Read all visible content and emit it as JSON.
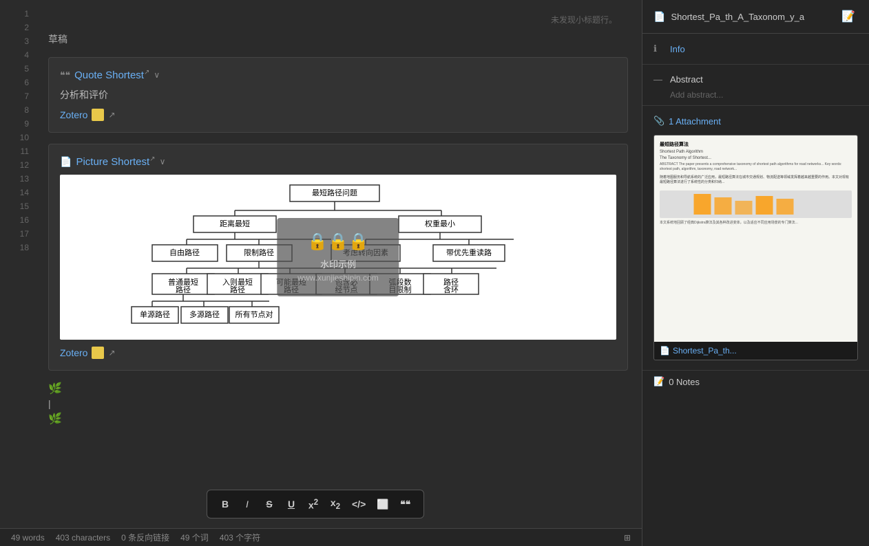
{
  "app": {
    "title": "草稿",
    "no_heading_text": "未发现小标题行。"
  },
  "editor": {
    "line_numbers": [
      1,
      2,
      3,
      4,
      5,
      6,
      7,
      8,
      9,
      10,
      11,
      12,
      13,
      14,
      15,
      16,
      17,
      18
    ],
    "blocks": [
      {
        "id": "quote-block",
        "type": "quote",
        "title": "Quote Shortest",
        "subtitle": "分析和评价",
        "zotero_label": "Zotero",
        "has_link_icon": true
      },
      {
        "id": "picture-block",
        "type": "picture",
        "title": "Picture Shortest",
        "zotero_label": "Zotero",
        "has_link_icon": true
      }
    ],
    "tree_diagram": {
      "root": "最短路径问题",
      "level1": [
        "距离最短",
        "权重最小"
      ],
      "level2_left": [
        "自由路径",
        "限制路径",
        "考虑转向因素",
        "带优先重读路"
      ],
      "level2_right": [],
      "level3": [
        "普通最短路径",
        "入则最短路径",
        "可能最短路径",
        "包含必经节点",
        "弧段数目限制",
        "路径含环"
      ],
      "level4": [
        "单源路径",
        "多源路径",
        "所有节点对"
      ]
    },
    "watermark": {
      "text": "水印示例",
      "url": "www.xunjieshipin.com"
    }
  },
  "toolbar": {
    "bold": "B",
    "italic": "I",
    "strikethrough": "S",
    "underline": "U",
    "superscript": "x²",
    "subscript": "x₂",
    "code": "</>",
    "box": "□",
    "quote": "❝"
  },
  "status_bar": {
    "words": "49 words",
    "characters": "403 characters",
    "backlinks": "0 条反向链接",
    "word_count_cn": "49 个词",
    "char_count_cn": "403 个字符"
  },
  "right_panel": {
    "title": "Shortest_Pa_th_A_Taxonom_y_a",
    "sections": {
      "info_label": "Info",
      "abstract_label": "Abstract",
      "abstract_placeholder": "Add abstract...",
      "attachment_label": "1 Attachment",
      "attachment_filename": "Shortest_Pa_th...",
      "notes_label": "0 Notes"
    },
    "pdf_content": {
      "title": "最短路径算法",
      "subtitle": "Shortest Path Algorithm",
      "taxonomy_label": "The Taxonomy of Shortest..."
    }
  },
  "cursor_emojis": [
    "🌿",
    "I",
    "🌿"
  ]
}
